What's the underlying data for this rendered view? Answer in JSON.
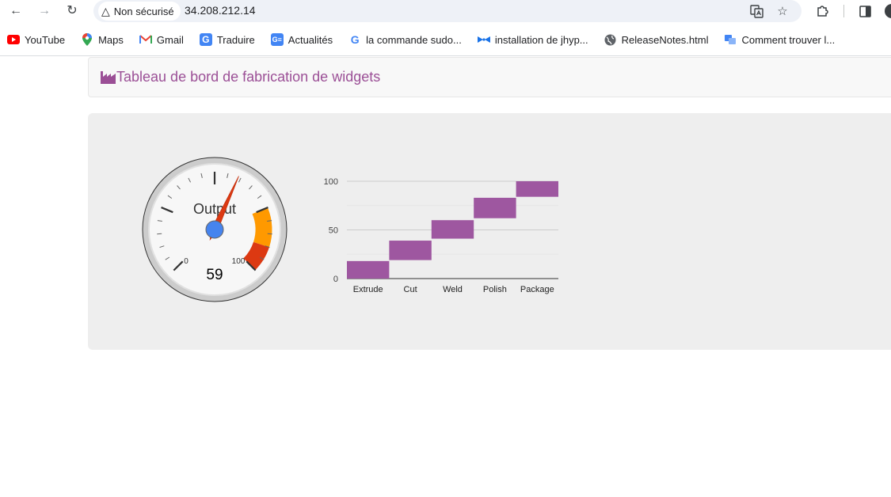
{
  "browser": {
    "security_label": "Non sécurisé",
    "url": "34.208.212.14",
    "bookmarks": [
      {
        "label": "YouTube"
      },
      {
        "label": "Maps"
      },
      {
        "label": "Gmail"
      },
      {
        "label": "Traduire"
      },
      {
        "label": "Actualités"
      },
      {
        "label": "la commande sudo..."
      },
      {
        "label": "installation de jhyp..."
      },
      {
        "label": "ReleaseNotes.html"
      },
      {
        "label": "Comment trouver l..."
      }
    ]
  },
  "page": {
    "brand_title": "Tableau de bord de fabrication de widgets"
  },
  "colors": {
    "brand": "#9b4f96",
    "bar": "#9e57a0",
    "gauge_yellow": "#ff9900",
    "gauge_red": "#dc3912",
    "gauge_needle": "#dc3912",
    "gauge_hub": "#4684ee"
  },
  "gauge": {
    "label": "Output",
    "value": 59,
    "value_text": "59",
    "min": 0,
    "max": 100,
    "min_label": "0",
    "max_label": "100",
    "yellow_band": [
      75,
      90
    ],
    "red_band": [
      90,
      100
    ]
  },
  "chart_data": {
    "type": "bar",
    "subtype": "waterfall",
    "categories": [
      "Extrude",
      "Cut",
      "Weld",
      "Polish",
      "Package"
    ],
    "ranges": [
      [
        0,
        18
      ],
      [
        19,
        39
      ],
      [
        41,
        60
      ],
      [
        62,
        83
      ],
      [
        84,
        100
      ]
    ],
    "ylim": [
      0,
      100
    ],
    "yticks": [
      0,
      50,
      100
    ],
    "minor_gridlines": [
      25,
      75
    ],
    "grid": true,
    "legend": "none"
  }
}
